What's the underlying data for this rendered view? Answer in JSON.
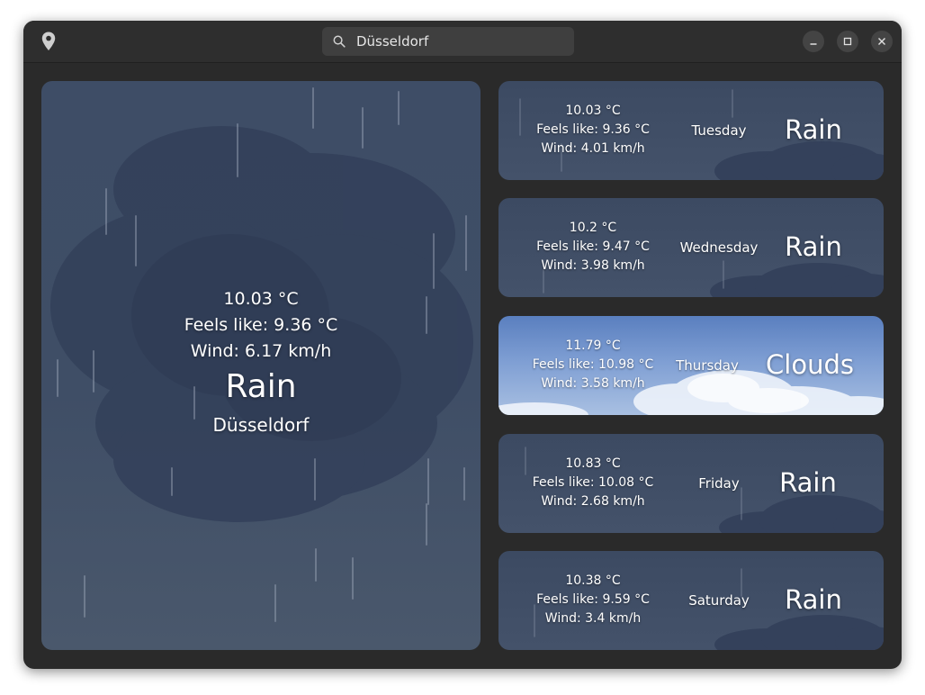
{
  "search": {
    "value": "Düsseldorf"
  },
  "current": {
    "temp": "10.03 °C",
    "feels_like": "Feels like: 9.36 °C",
    "wind": "Wind: 6.17 km/h",
    "condition": "Rain",
    "city": "Düsseldorf"
  },
  "forecast": [
    {
      "temp": "10.03 °C",
      "feels_like": "Feels like: 9.36 °C",
      "wind": "Wind: 4.01 km/h",
      "day": "Tuesday",
      "condition": "Rain"
    },
    {
      "temp": "10.2 °C",
      "feels_like": "Feels like: 9.47 °C",
      "wind": "Wind: 3.98 km/h",
      "day": "Wednesday",
      "condition": "Rain"
    },
    {
      "temp": "11.79 °C",
      "feels_like": "Feels like: 10.98 °C",
      "wind": "Wind: 3.58 km/h",
      "day": "Thursday",
      "condition": "Clouds"
    },
    {
      "temp": "10.83 °C",
      "feels_like": "Feels like: 10.08 °C",
      "wind": "Wind: 2.68 km/h",
      "day": "Friday",
      "condition": "Rain"
    },
    {
      "temp": "10.38 °C",
      "feels_like": "Feels like: 9.59 °C",
      "wind": "Wind: 3.4 km/h",
      "day": "Saturday",
      "condition": "Rain"
    }
  ],
  "icons": {
    "location": "map-pin-icon",
    "search": "search-icon",
    "minimize": "minimize-icon",
    "maximize": "maximize-icon",
    "close": "close-icon"
  },
  "colors": {
    "window_bg": "#2a2a2a",
    "rain_card": "#3f4e66",
    "clouds_card": "#7e9ed3"
  }
}
